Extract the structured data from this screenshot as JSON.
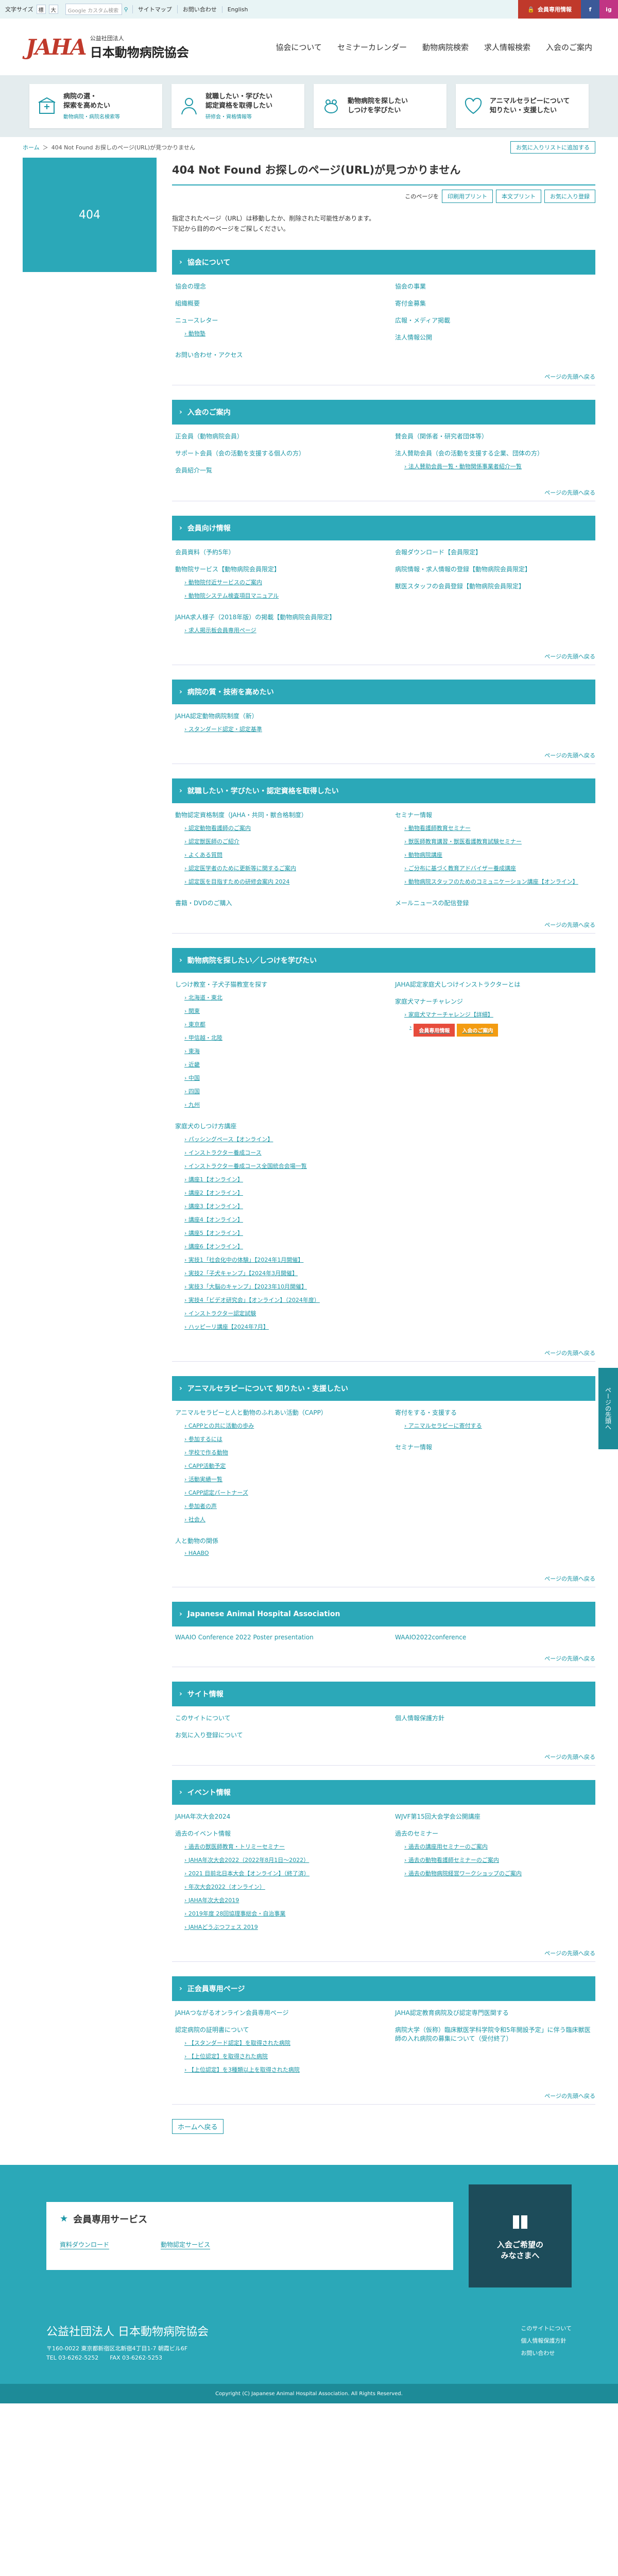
{
  "topbar": {
    "font_size_label": "文字サイズ",
    "font_sizes": [
      "標",
      "大"
    ],
    "search_placeholder": "Google カスタム検索",
    "links": [
      "サイトマップ",
      "お問い合わせ",
      "English"
    ],
    "member_button": "会員専用情報",
    "social": [
      "f",
      "ig"
    ]
  },
  "header": {
    "logo_mark": "JAHA",
    "org_sub": "公益社団法人",
    "org_main": "日本動物病院協会",
    "nav": [
      "協会について",
      "セミナーカレンダー",
      "動物病院検索",
      "求人情報検索",
      "入会のご案内"
    ]
  },
  "categories": [
    {
      "label": "病院の選・\n探索を高めたい",
      "sub": "動物病院・病院名検索等"
    },
    {
      "label": "就職したい・学びたい\n認定資格を取得したい",
      "sub": "研修会・資格情報等"
    },
    {
      "label": "動物病院を探したい\nしつけを学びたい",
      "sub": ""
    },
    {
      "label": "アニマルセラピーについて\n知りたい・支援したい",
      "sub": ""
    }
  ],
  "breadcrumb": {
    "home": "ホーム",
    "sep": "＞",
    "current": "404 Not Found お探しのページ(URL)が見つかりません",
    "add_fav": "お気に入りリストに追加する"
  },
  "sidebar": {
    "label": "404"
  },
  "page": {
    "title": "404 Not Found お探しのページ(URL)が見つかりません",
    "tools_label": "このページを",
    "tool_buttons": [
      "印刷用プリント",
      "本文プリント",
      "お気に入り登録"
    ],
    "lead1": "指定されたページ（URL）は移動したか、削除された可能性があります。",
    "lead2": "下記から目的のページをご探しください。",
    "back_label": "ページの先頭へ戻る"
  },
  "sections": [
    {
      "title": "協会について",
      "cols": [
        [
          {
            "t": "協会の理念"
          },
          {
            "t": "組織概要"
          },
          {
            "t": "ニュースレター",
            "sub": [
              "動物塾"
            ]
          },
          {
            "t": "お問い合わせ・アクセス"
          }
        ],
        [
          {
            "t": "協会の事業"
          },
          {
            "t": "寄付金募集"
          },
          {
            "t": "広報・メディア掲載"
          },
          {
            "t": "法人情報公開"
          }
        ]
      ]
    },
    {
      "title": "入会のご案内",
      "cols": [
        [
          {
            "t": "正会員（動物病院会員）"
          },
          {
            "t": "サポート会員（会の活動を支援する個人の方）"
          },
          {
            "t": "会員紹介一覧"
          }
        ],
        [
          {
            "t": "賛会員（関係者・研究者団体等）"
          },
          {
            "t": "法人賛助会員（会の活動を支援する企業、団体の方）",
            "sub": [
              "法人賛助会員一覧・動物関係事業者紹介一覧"
            ]
          }
        ]
      ]
    },
    {
      "title": "会員向け情報",
      "cols": [
        [
          {
            "t": "会員資料（予約5年）"
          },
          {
            "t": "動物院サービス【動物病院会員限定】",
            "sub": [
              "動物院付近サービスのご案内",
              "動物院システム検査項目マニュアル"
            ]
          },
          {
            "t": "JAHA求人様子（2018年版）の掲載【動物病院会員限定】",
            "sub": [
              "求人掲示板会員専用ページ"
            ]
          }
        ],
        [
          {
            "t": "会報ダウンロード【会員限定】"
          },
          {
            "t": "病院情報・求人情報の登録【動物病院会員限定】"
          },
          {
            "t": "獣医スタッフの会員登録【動物病院会員限定】"
          }
        ]
      ]
    },
    {
      "title": "病院の質・技術を高めたい",
      "cols": [
        [
          {
            "t": "JAHA認定動物病院制度（新）",
            "sub": [
              "スタンダード認定・認定基準"
            ]
          }
        ],
        []
      ]
    },
    {
      "title": "就職したい・学びたい・認定資格を取得したい",
      "cols": [
        [
          {
            "t": "動物認定資格制度（JAHA・共同・獣合格制度）",
            "sub": [
              "認定動物看護師のご案内",
              "認定獣医師のご紹介",
              "よくある質問",
              "認定医学者のために更新等に関するご案内",
              "認定医を目指すための研修会案内 2024"
            ]
          },
          {
            "t": "書籍・DVDのご購入"
          }
        ],
        [
          {
            "t": "セミナー情報",
            "sub": [
              "動物看護師教育セミナー",
              "獣医師教育講習・獣医看護教育試験セミナー",
              "動物病院講座",
              "ご分布に基づく教育アドバイザー養成講座",
              "動物病院スタッフのためのコミュニケーション講座【オンライン】"
            ]
          },
          {
            "t": "メールニュースの配信登録"
          }
        ]
      ]
    },
    {
      "title": "動物病院を探したい／しつけを学びたい",
      "cols": [
        [
          {
            "t": "しつけ教室・子犬子猫教室を探す",
            "sub": [
              "北海道・東北",
              "関東",
              "東京都",
              "甲信越・北陸",
              "東海",
              "近畿",
              "中国",
              "四国",
              "九州"
            ]
          },
          {
            "t": "家庭犬のしつけ方講座",
            "sub": [
              "パッシングペース【オンライン】",
              "インストラクター養成コース",
              "インストラクター養成コース全国統合会場一覧",
              "講座1【オンライン】",
              "講座2【オンライン】",
              "講座3【オンライン】",
              "講座4【オンライン】",
              "講座5【オンライン】",
              "講座6【オンライン】",
              "実技1「社会化中の体験」【2024年1月開催】",
              "実技2「子犬キャンプ」【2024年3月開催】",
              "実技3「大脳のキャンプ」【2023年10月開催】",
              "実技4「ビデオ研究会」【オンライン】（2024年度）",
              "インストラクター認定試験",
              "ハッピーリ講座【2024年7月】"
            ]
          }
        ],
        [
          {
            "t": "JAHA認定家庭犬しつけインストラクターとは"
          },
          {
            "t": "家庭犬マナーチャレンジ",
            "sub": [
              "家庭犬マナーチャレンジ【詳細】"
            ]
          }
        ]
      ]
    },
    {
      "title": "アニマルセラピーについて 知りたい・支援したい",
      "cols": [
        [
          {
            "t": "アニマルセラピーと人と動物のふれあい活動（CAPP）",
            "sub": [
              "CAPPとの共に活動の歩み",
              "参加するには",
              "学校で作る動物",
              "CAPP活動予定",
              "活動実績一覧",
              "CAPP認定パートナーズ",
              "参加者の声",
              "社会人"
            ]
          },
          {
            "t": "人と動物の関係",
            "sub": [
              "HAABO"
            ]
          }
        ],
        [
          {
            "t": "寄付をする・支援する",
            "sub": [
              "アニマルセラピーに寄付する"
            ]
          },
          {
            "t": "セミナー情報"
          }
        ]
      ]
    },
    {
      "title": "Japanese Animal Hospital Association",
      "cols": [
        [
          {
            "t": "WAAIO Conference 2022 Poster presentation"
          }
        ],
        [
          {
            "t": "WAAIO2022conference"
          }
        ]
      ]
    },
    {
      "title": "サイト情報",
      "cols": [
        [
          {
            "t": "このサイトについて"
          },
          {
            "t": "お気に入り登録について"
          }
        ],
        [
          {
            "t": "個人情報保護方針"
          }
        ]
      ]
    },
    {
      "title": "イベント情報",
      "cols": [
        [
          {
            "t": "JAHA年次大会2024"
          },
          {
            "t": "過去のイベント情報",
            "sub": [
              "過去の獣医師教育・トリミーセミナー",
              "JAHA年次大会2022（2022年8月1日〜2022）",
              "2021 目前北日本大会【オンライン】（終了済）",
              "年次大会2022（オンライン）",
              "JAHA年次大会2019",
              "2019年度 28回協理事総会・自治事業",
              "JAHAどうぶつフェス 2019"
            ]
          }
        ],
        [
          {
            "t": "WJVF第15回大会学会公開講座"
          },
          {
            "t": "過去のセミナー",
            "sub": [
              "過去の講座用セミナーのご案内",
              "過去の動物看護師セミナーのご案内",
              "過去の動物病院経営ワークショップのご案内"
            ]
          }
        ]
      ]
    },
    {
      "title": "正会員専用ページ",
      "cols": [
        [
          {
            "t": "JAHAつながるオンライン会員専用ページ"
          },
          {
            "t": "認定病院の証明書について",
            "sub": [
              "【スタンダード認定】を取得された病院",
              "【上位認定】を取得された病院",
              "【上位認定】を3種類以上を取得された病院"
            ]
          }
        ],
        [
          {
            "t": "JAHA認定教育病院及び認定専門医関する"
          },
          {
            "t": "病院大学（仮称）臨床獣医学科学院令和5年開設予定」に伴う臨床獣医師の入れ病院の募集について（受付終了）"
          }
        ]
      ]
    }
  ],
  "popup": [
    "会員専用情報",
    "入会のご案内"
  ],
  "sidetab": "ページの先頭へ",
  "back_home": "ホームへ戻る",
  "member_service": {
    "title": "会員専用サービス",
    "links": [
      "資料ダウンロード",
      "動物認定サービス"
    ],
    "join_label": "入会ご希望の\nみなさまへ"
  },
  "footer": {
    "name": "公益社団法人 日本動物病院協会",
    "addr1": "〒160-0022 東京都新宿区北新宿4丁目1-7 朝霞ビル6F",
    "addr2": "TEL 03-6262-5252　　FAX 03-6262-5253",
    "links": [
      "このサイトについて",
      "個人情報保護方針",
      "お問い合わせ"
    ],
    "copyright": "Copyright (C) Japanese Animal Hospital Association. All Rights Reserved."
  }
}
